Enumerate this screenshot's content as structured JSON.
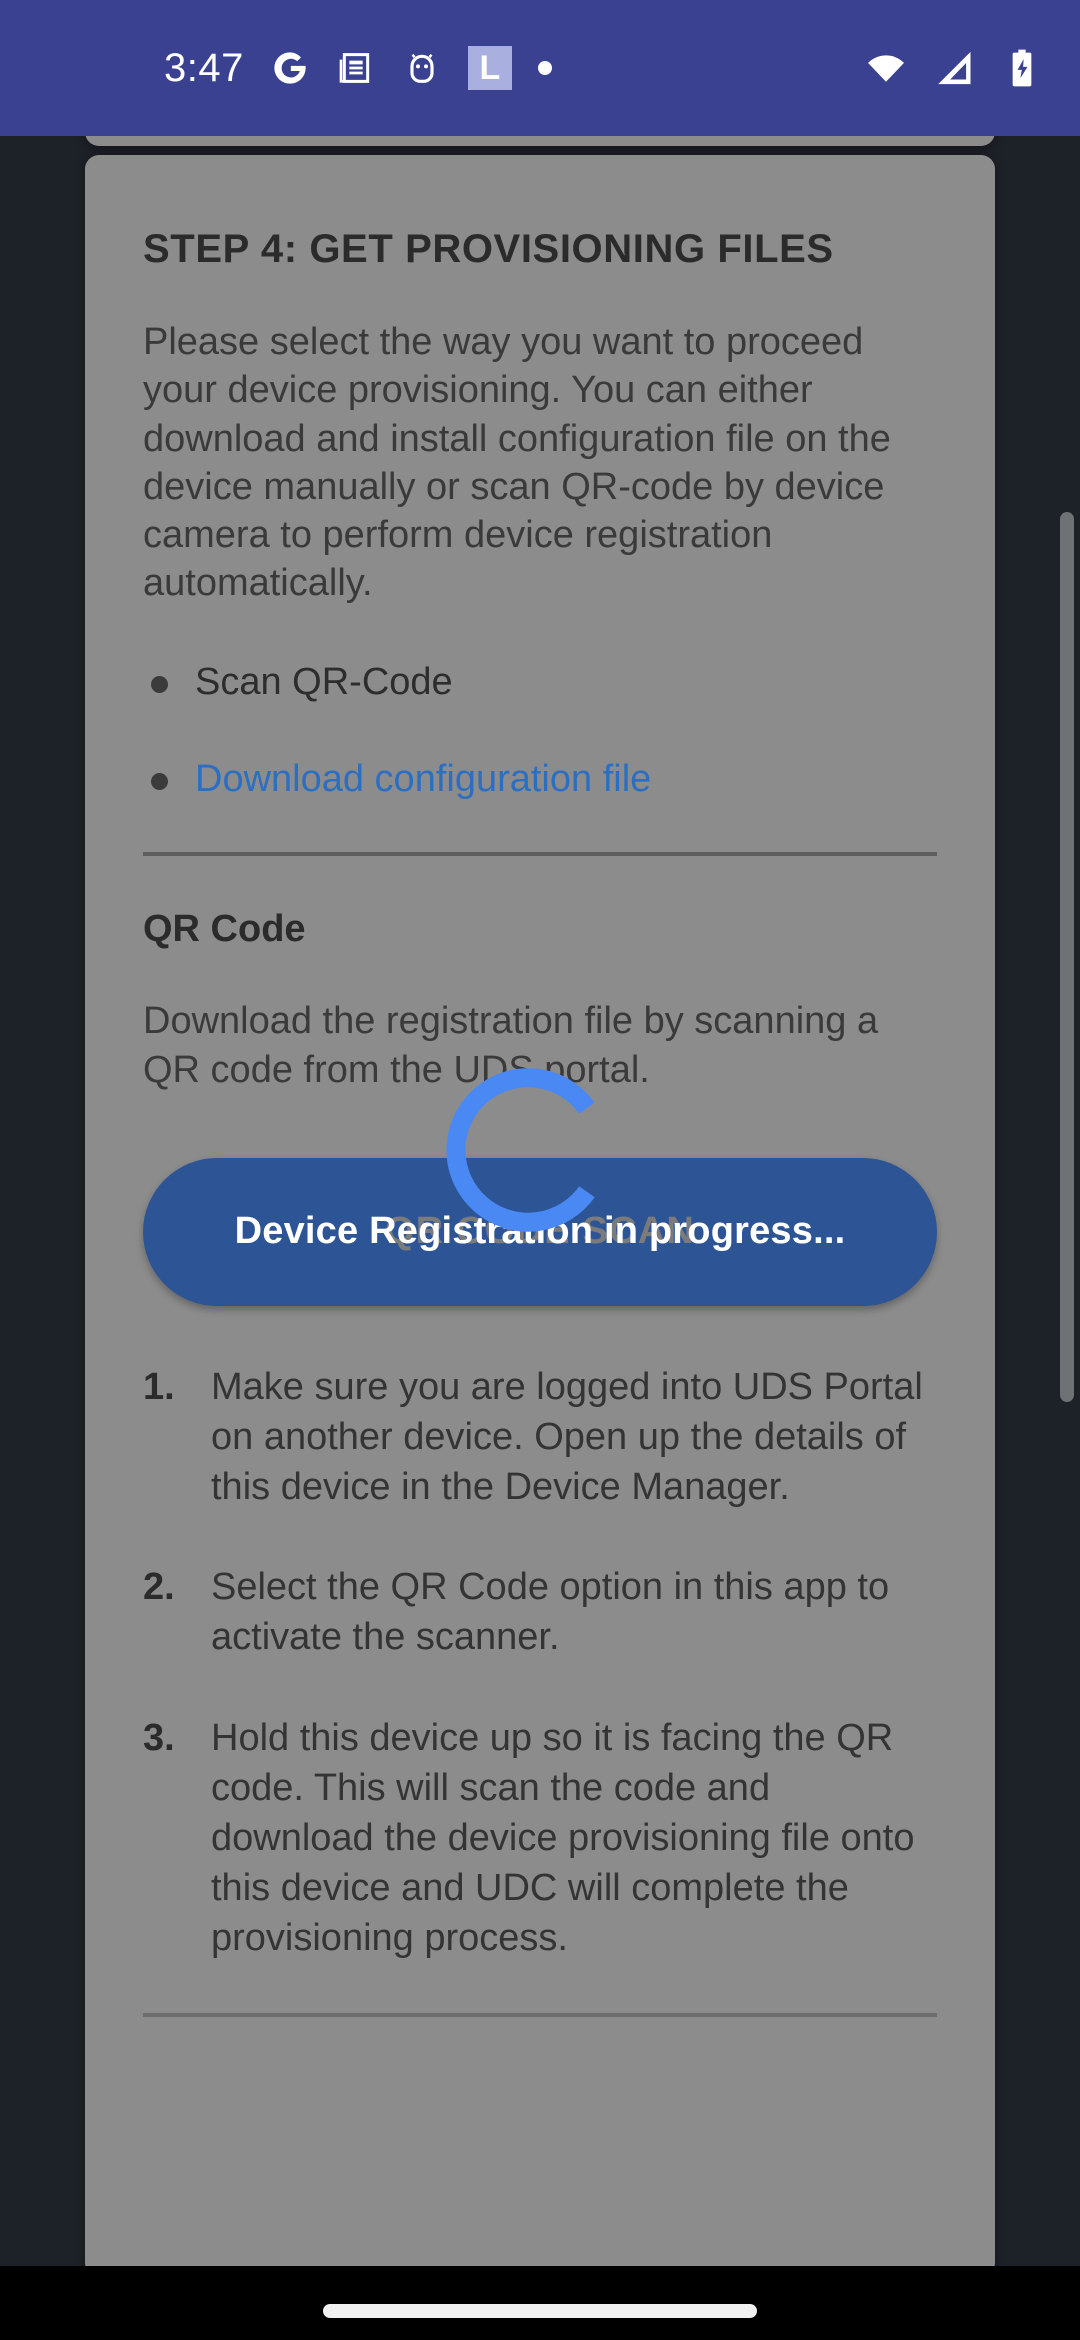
{
  "statusbar": {
    "time": "3:47",
    "left_icons": [
      {
        "name": "google-g-icon",
        "glyph": "G"
      },
      {
        "name": "news-article-icon",
        "glyph": "☷"
      },
      {
        "name": "android-head-icon",
        "glyph": "◔"
      },
      {
        "name": "linkedin-badge-icon",
        "glyph": "L"
      },
      {
        "name": "notification-dot-icon",
        "glyph": "•"
      }
    ],
    "right_icons": [
      {
        "name": "wifi-icon"
      },
      {
        "name": "cellular-signal-icon"
      },
      {
        "name": "battery-charging-icon"
      }
    ],
    "bg_color": "#3a4191"
  },
  "card": {
    "title": "STEP 4: GET PROVISIONING FILES",
    "intro": "Please select the way you want to proceed your device provisioning. You can either download and install configuration file on the device manually or scan QR-code by device camera to perform device registration automatically.",
    "options": [
      {
        "label": "Scan QR-Code",
        "is_link": false
      },
      {
        "label": "Download configuration file",
        "is_link": true
      }
    ],
    "section_heading": "QR Code",
    "section_text": "Download the registration file by scanning a QR code from the UDS portal.",
    "button": {
      "base_label": "QR CODE SCAN",
      "overlay_label": "Device Registration in progress...",
      "bg_color": "#2d5596"
    },
    "steps": [
      {
        "num": "1.",
        "text": "Make sure you are logged into UDS Portal on another device. Open up the details of this device in the Device Manager."
      },
      {
        "num": "2.",
        "text": "Select the QR Code option in this app to activate the scanner."
      },
      {
        "num": "3.",
        "text": "Hold this device up so it is facing the QR code. This will scan the code and download the device provisioning file onto this device and UDC will complete the provisioning process."
      }
    ],
    "bg_color": "#8c8c8c",
    "link_color": "#2c6fc2"
  },
  "spinner": {
    "name": "loading-spinner",
    "color": "#4a89f3"
  },
  "page_bg_color": "#1d2128"
}
